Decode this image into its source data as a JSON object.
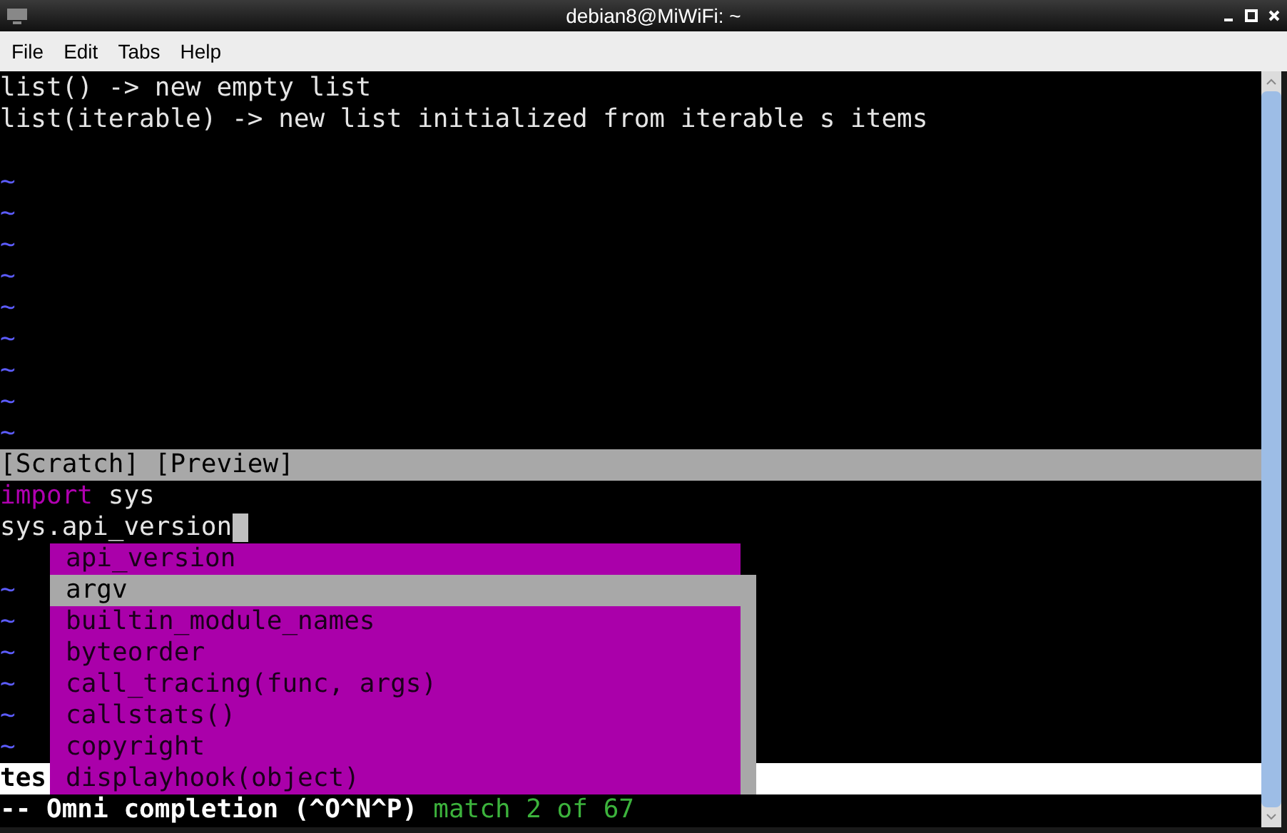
{
  "window": {
    "title": "debian8@MiWiFi: ~"
  },
  "menu": [
    "File",
    "Edit",
    "Tabs",
    "Help"
  ],
  "preview": {
    "lines": [
      {
        "kind": "text",
        "text": "list() -> new empty list"
      },
      {
        "kind": "text",
        "text": "list(iterable) -> new list initialized from iterable s items"
      },
      {
        "kind": "empty"
      },
      {
        "kind": "tilde",
        "text": "~"
      },
      {
        "kind": "tilde",
        "text": "~"
      },
      {
        "kind": "tilde",
        "text": "~"
      },
      {
        "kind": "tilde",
        "text": "~"
      },
      {
        "kind": "tilde",
        "text": "~"
      },
      {
        "kind": "tilde",
        "text": "~"
      },
      {
        "kind": "tilde",
        "text": "~"
      },
      {
        "kind": "tilde",
        "text": "~"
      },
      {
        "kind": "tilde",
        "text": "~"
      }
    ],
    "status": "[Scratch] [Preview]"
  },
  "buffer": {
    "lines": [
      {
        "kind": "code",
        "segments": [
          {
            "kind": "keyword",
            "text": "import"
          },
          {
            "kind": "normal",
            "text": " sys"
          }
        ],
        "cursor": false
      },
      {
        "kind": "code",
        "segments": [
          {
            "kind": "normal",
            "text": "sys.api_version"
          }
        ],
        "cursor": true
      },
      {
        "kind": "empty"
      },
      {
        "kind": "tilde",
        "text": "~"
      },
      {
        "kind": "tilde",
        "text": "~"
      },
      {
        "kind": "tilde",
        "text": "~"
      },
      {
        "kind": "tilde",
        "text": "~"
      },
      {
        "kind": "tilde",
        "text": "~"
      },
      {
        "kind": "tilde",
        "text": "~"
      }
    ],
    "status": "tes"
  },
  "completion_menu": {
    "items": [
      {
        "label": "api_version",
        "selected": false
      },
      {
        "label": "argv",
        "selected": true
      },
      {
        "label": "builtin_module_names",
        "selected": false
      },
      {
        "label": "byteorder",
        "selected": false
      },
      {
        "label": "call_tracing(func, args)",
        "selected": false
      },
      {
        "label": "callstats()",
        "selected": false
      },
      {
        "label": "copyright",
        "selected": false
      },
      {
        "label": "displayhook(object)",
        "selected": false
      }
    ]
  },
  "mode_line": {
    "mode": "-- Omni completion (^O^N^P)",
    "match": "match 2 of 67"
  }
}
